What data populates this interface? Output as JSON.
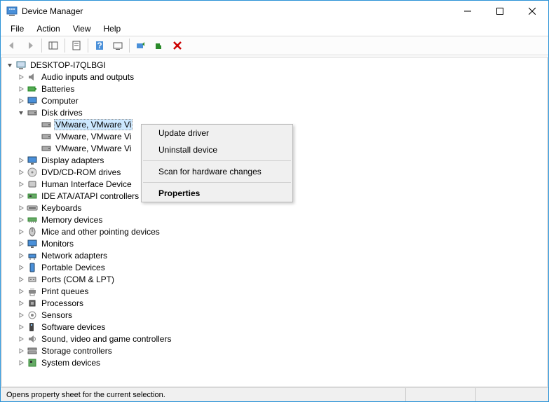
{
  "window": {
    "title": "Device Manager"
  },
  "menu": {
    "file": "File",
    "action": "Action",
    "view": "View",
    "help": "Help"
  },
  "root": {
    "name": "DESKTOP-I7QLBGI"
  },
  "categories": [
    {
      "label": "Audio inputs and outputs",
      "expanded": false,
      "icon": "speaker"
    },
    {
      "label": "Batteries",
      "expanded": false,
      "icon": "battery"
    },
    {
      "label": "Computer",
      "expanded": false,
      "icon": "computer"
    },
    {
      "label": "Disk drives",
      "expanded": true,
      "icon": "disk",
      "children": [
        {
          "label": "VMware, VMware Vi",
          "selected": true
        },
        {
          "label": "VMware, VMware Vi",
          "selected": false
        },
        {
          "label": "VMware, VMware Vi",
          "selected": false
        }
      ]
    },
    {
      "label": "Display adapters",
      "expanded": false,
      "icon": "display"
    },
    {
      "label": "DVD/CD-ROM drives",
      "expanded": false,
      "icon": "dvd"
    },
    {
      "label": "Human Interface Device",
      "expanded": false,
      "icon": "hid"
    },
    {
      "label": "IDE ATA/ATAPI controllers",
      "expanded": false,
      "icon": "ide"
    },
    {
      "label": "Keyboards",
      "expanded": false,
      "icon": "keyboard"
    },
    {
      "label": "Memory devices",
      "expanded": false,
      "icon": "memory"
    },
    {
      "label": "Mice and other pointing devices",
      "expanded": false,
      "icon": "mouse"
    },
    {
      "label": "Monitors",
      "expanded": false,
      "icon": "monitor"
    },
    {
      "label": "Network adapters",
      "expanded": false,
      "icon": "network"
    },
    {
      "label": "Portable Devices",
      "expanded": false,
      "icon": "portable"
    },
    {
      "label": "Ports (COM & LPT)",
      "expanded": false,
      "icon": "port"
    },
    {
      "label": "Print queues",
      "expanded": false,
      "icon": "printer"
    },
    {
      "label": "Processors",
      "expanded": false,
      "icon": "cpu"
    },
    {
      "label": "Sensors",
      "expanded": false,
      "icon": "sensor"
    },
    {
      "label": "Software devices",
      "expanded": false,
      "icon": "software"
    },
    {
      "label": "Sound, video and game controllers",
      "expanded": false,
      "icon": "sound"
    },
    {
      "label": "Storage controllers",
      "expanded": false,
      "icon": "storage"
    },
    {
      "label": "System devices",
      "expanded": false,
      "icon": "system"
    }
  ],
  "context_menu": {
    "update": "Update driver",
    "uninstall": "Uninstall device",
    "scan": "Scan for hardware changes",
    "properties": "Properties"
  },
  "status": {
    "text": "Opens property sheet for the current selection."
  }
}
